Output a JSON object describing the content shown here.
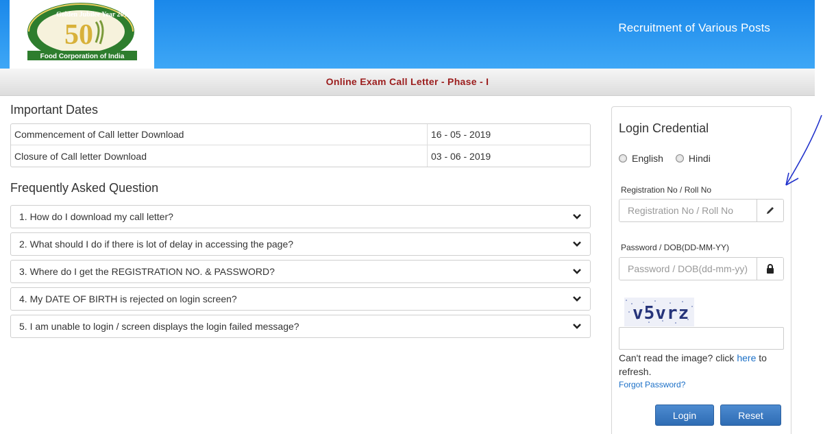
{
  "header": {
    "logo_alt": "Food Corporation of India Golden Jubilee",
    "logo_text": {
      "years": "Golden Jubilee Year 2014-2015",
      "number": "50",
      "org": "Food Corporation of India"
    },
    "title": "Recruitment of Various Posts"
  },
  "subbar": {
    "title": "Online Exam Call Letter - Phase - I"
  },
  "important_dates": {
    "title": "Important Dates",
    "rows": [
      {
        "label": "Commencement of Call letter Download",
        "value": "16 - 05 - 2019"
      },
      {
        "label": "Closure of Call letter Download",
        "value": "03 - 06 - 2019"
      }
    ]
  },
  "faq": {
    "title": "Frequently Asked Question",
    "items": [
      {
        "q": "1. How do I download my call letter?"
      },
      {
        "q": "2. What should I do if there is lot of delay in accessing the page?"
      },
      {
        "q": "3. Where do I get the REGISTRATION NO. & PASSWORD?"
      },
      {
        "q": "4. My DATE OF BIRTH is rejected on login screen?"
      },
      {
        "q": "5. I am unable to login / screen displays the login failed message?"
      }
    ]
  },
  "login": {
    "title": "Login Credential",
    "languages": [
      "English",
      "Hindi"
    ],
    "reg_label": "Registration No / Roll No",
    "reg_placeholder": "Registration No / Roll No",
    "pwd_label": "Password / DOB(DD-MM-YY)",
    "pwd_placeholder": "Password / DOB(dd-mm-yy)",
    "captcha_text": "v5vrz",
    "refresh_prefix": "Can't read the image? click ",
    "refresh_link": "here",
    "refresh_suffix": " to refresh.",
    "forgot": "Forgot Password?",
    "login_button": "Login",
    "reset_button": "Reset"
  },
  "colors": {
    "header_blue": "#2b98ef",
    "subtitle_red": "#9b1c1c",
    "button_blue": "#3a7bc4",
    "link_blue": "#1a6fc7"
  }
}
